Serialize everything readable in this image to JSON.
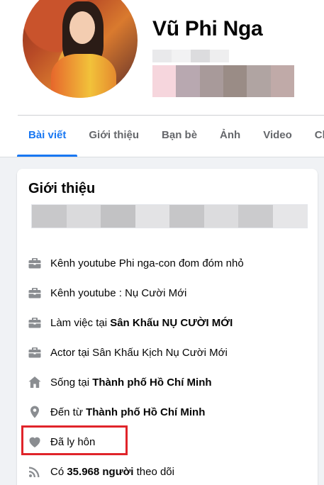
{
  "profile": {
    "name": "Vũ Phi Nga",
    "blur_small_colors": [
      "#e9e9eb",
      "#f2f2f3",
      "#dcdcde",
      "#eeeeef"
    ],
    "blur_big_colors": [
      "#f6d6dd",
      "#b8a8b0",
      "#a89a9a",
      "#9a8c86",
      "#b0a4a2",
      "#c0aaa8"
    ]
  },
  "tabs": [
    {
      "label": "Bài viết",
      "active": true
    },
    {
      "label": "Giới thiệu"
    },
    {
      "label": "Bạn bè"
    },
    {
      "label": "Ảnh"
    },
    {
      "label": "Video"
    },
    {
      "label": "Ch"
    }
  ],
  "intro": {
    "title": "Giới thiệu",
    "bio_blur_colors": [
      "#c8c8ca",
      "#dadadc",
      "#c2c2c4",
      "#e3e3e5",
      "#c6c6c8",
      "#dcdcde",
      "#cbcbcd",
      "#e6e6e8"
    ],
    "items": [
      {
        "icon": "briefcase-icon",
        "prefix": "Kênh youtube Phi nga-con đom đóm nhỏ",
        "bold": "",
        "suffix": ""
      },
      {
        "icon": "briefcase-icon",
        "prefix": "Kênh youtube : Nụ Cười Mới",
        "bold": "",
        "suffix": ""
      },
      {
        "icon": "briefcase-icon",
        "prefix": "Làm việc tại ",
        "bold": "Sân Khấu NỤ CƯỜI MỚI",
        "suffix": ""
      },
      {
        "icon": "briefcase-icon",
        "prefix": "Actor tại Sân Khấu Kịch Nụ Cười Mới",
        "bold": "",
        "suffix": ""
      },
      {
        "icon": "home-icon",
        "prefix": "Sống tại ",
        "bold": "Thành phố Hồ Chí Minh",
        "suffix": ""
      },
      {
        "icon": "location-pin-icon",
        "prefix": "Đến từ ",
        "bold": "Thành phố Hồ Chí Minh",
        "suffix": ""
      },
      {
        "icon": "heart-icon",
        "prefix": "Đã ly hôn",
        "bold": "",
        "suffix": ""
      },
      {
        "icon": "rss-icon",
        "prefix": "Có ",
        "bold": "35.968 người",
        "suffix": " theo dõi"
      }
    ]
  },
  "colors": {
    "accent": "#1877f2",
    "highlight": "#e0242a",
    "icon": "#8a8d91"
  }
}
